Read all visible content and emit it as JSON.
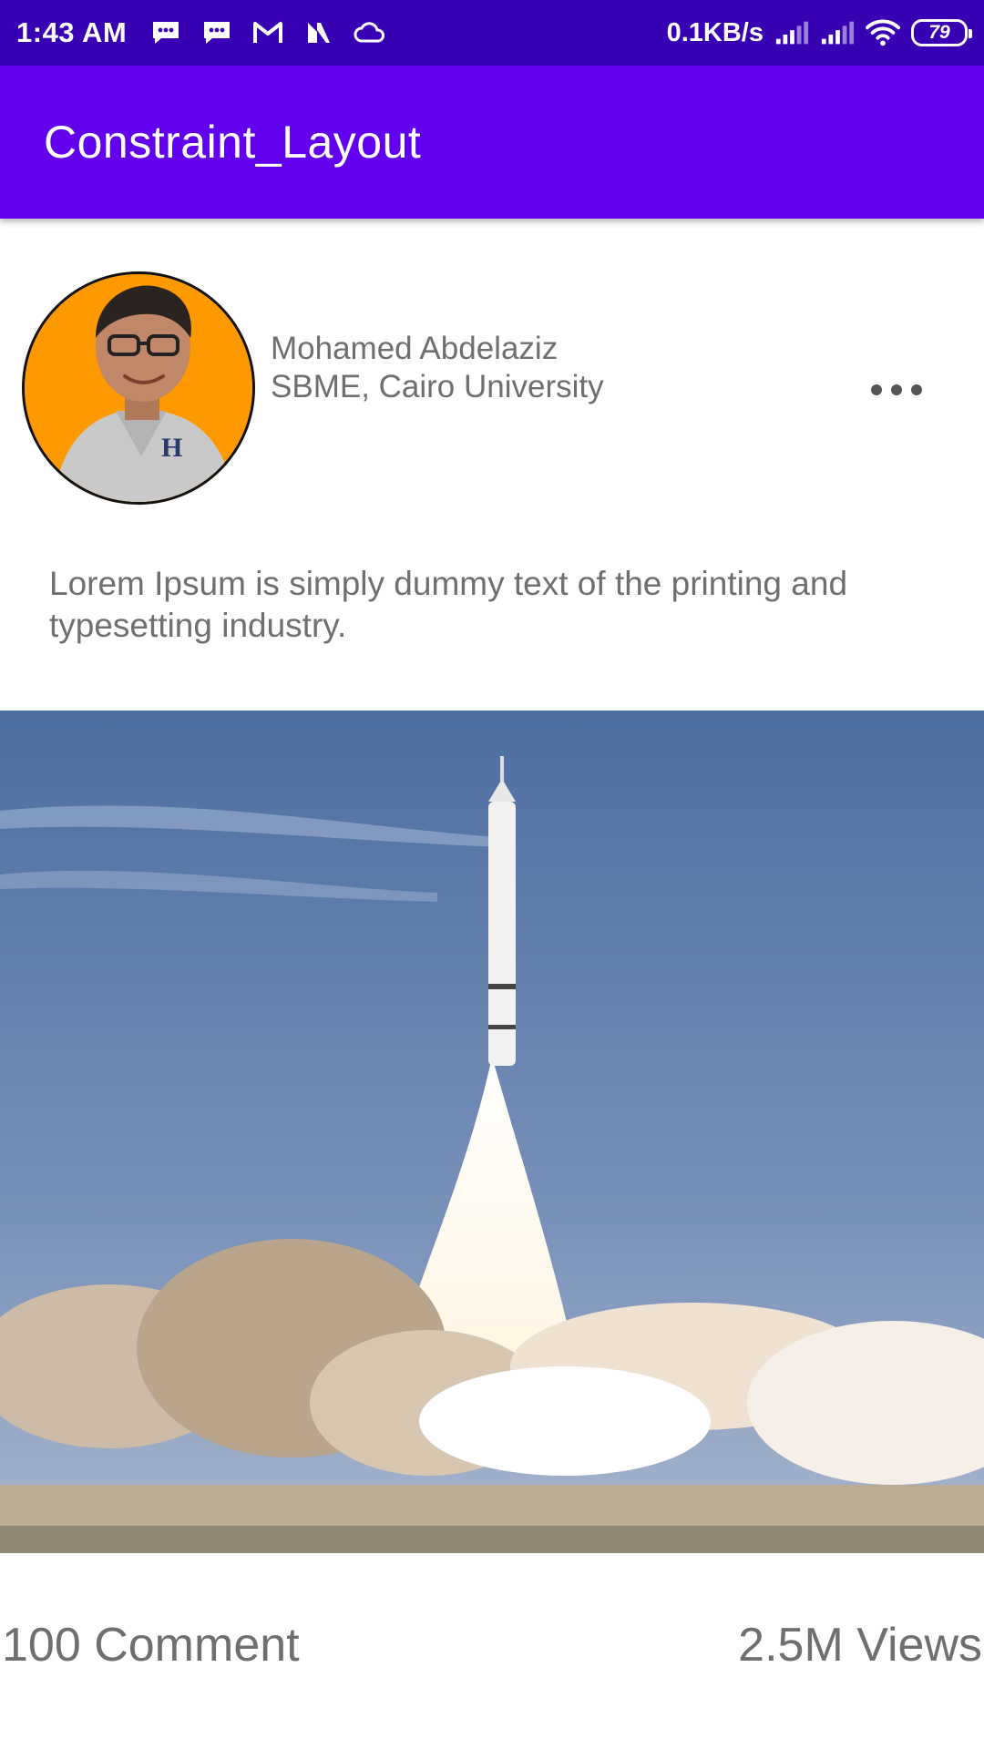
{
  "status_bar": {
    "time": "1:43 AM",
    "notification_icons": [
      "message-icon",
      "message-icon",
      "gmail-icon",
      "n-icon",
      "cloud-icon"
    ],
    "net_speed": "0.1KB/s",
    "battery_level": "79",
    "background_color": "#3700b3"
  },
  "app_bar": {
    "title": "Constraint_Layout",
    "background_color": "#6200ee"
  },
  "post": {
    "author_name": "Mohamed Abdelaziz",
    "author_affiliation": "SBME, Cairo University",
    "more_icon": "more-horizontal-icon",
    "text": "Lorem Ipsum is simply dummy text of the printing and typesetting industry.",
    "image_subject": "rocket-launch-image",
    "comments": "100 Comment",
    "views": "2.5M Views"
  },
  "colors": {
    "text_secondary": "#6f6f6f",
    "avatar_background": "#ff9900"
  }
}
